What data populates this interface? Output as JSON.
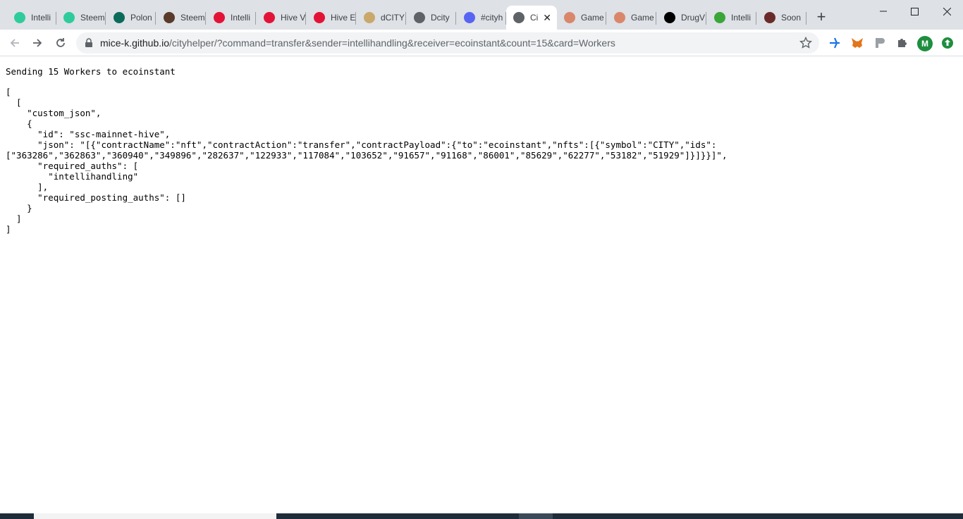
{
  "tabs": [
    {
      "label": "Intelli",
      "icon": "hive-hub-icon",
      "color": "#2ecc9a"
    },
    {
      "label": "Steem",
      "icon": "steem-icon",
      "color": "#2ecc9a"
    },
    {
      "label": "Polon",
      "icon": "poloniex-icon",
      "color": "#0b6b5b"
    },
    {
      "label": "Steem",
      "icon": "steem-gear-icon",
      "color": "#5a3a2a"
    },
    {
      "label": "Intelli",
      "icon": "hive-icon",
      "color": "#e31337"
    },
    {
      "label": "Hive V",
      "icon": "hive-icon",
      "color": "#e31337"
    },
    {
      "label": "Hive E",
      "icon": "hive-engine-icon",
      "color": "#e31337"
    },
    {
      "label": "dCITY",
      "icon": "dcity-icon",
      "color": "#c9a86a"
    },
    {
      "label": "Dcity",
      "icon": "globe-icon",
      "color": "#5f6368"
    },
    {
      "label": "#cityh",
      "icon": "discord-icon",
      "color": "#5865f2"
    },
    {
      "label": "Ci",
      "icon": "globe-icon",
      "color": "#5f6368",
      "active": true
    },
    {
      "label": "Game",
      "icon": "game-icon",
      "color": "#d9876b"
    },
    {
      "label": "Game",
      "icon": "game-icon",
      "color": "#d9876b"
    },
    {
      "label": "DrugV",
      "icon": "dw-icon",
      "color": "#000000"
    },
    {
      "label": "Intelli",
      "icon": "cannabis-icon",
      "color": "#3aa63a"
    },
    {
      "label": "Soon",
      "icon": "soon-icon",
      "color": "#6b2a2a"
    }
  ],
  "address_bar": {
    "domain": "mice-k.github.io",
    "path": "/cityhelper/?command=transfer&sender=intellihandling&receiver=ecoinstant&count=15&card=Workers"
  },
  "profile": {
    "initial": "M",
    "color": "#1e8e3e"
  },
  "page": {
    "heading": "Sending 15 Workers to ecoinstant",
    "json_lines": [
      "[",
      "  [",
      "    \"custom_json\",",
      "    {",
      "      \"id\": \"ssc-mainnet-hive\",",
      "      \"json\": \"[{\"contractName\":\"nft\",\"contractAction\":\"transfer\",\"contractPayload\":{\"to\":\"ecoinstant\",\"nfts\":[{\"symbol\":\"CITY\",\"ids\":",
      "[\"363286\",\"362863\",\"360940\",\"349896\",\"282637\",\"122933\",\"117084\",\"103652\",\"91657\",\"91168\",\"86001\",\"85629\",\"62277\",\"53182\",\"51929\"]}]}}]\",",
      "      \"required_auths\": [",
      "        \"intellihandling\"",
      "      ],",
      "      \"required_posting_auths\": []",
      "    }",
      "  ]",
      "]"
    ]
  }
}
